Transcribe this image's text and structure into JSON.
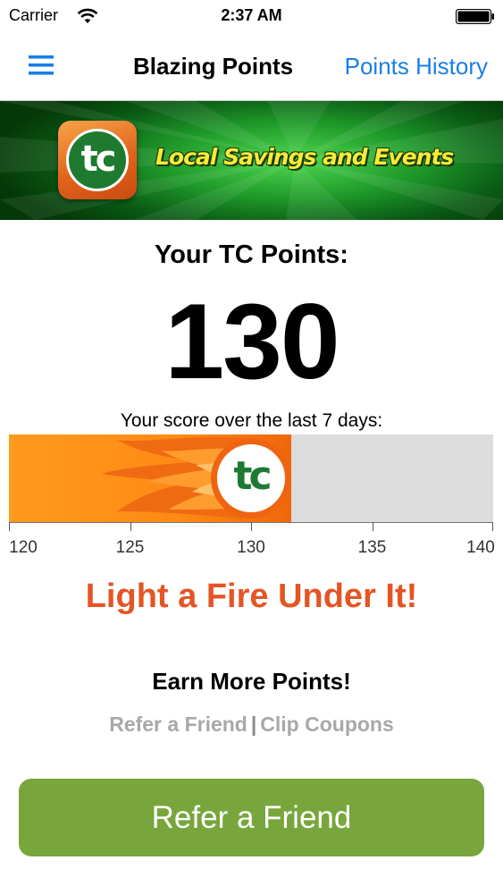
{
  "status_bar": {
    "carrier": "Carrier",
    "time": "2:37 AM",
    "icons": [
      "wifi-icon",
      "battery-icon"
    ]
  },
  "nav": {
    "menu_icon": "hamburger-menu-icon",
    "title": "Blazing Points",
    "link": "Points History",
    "link_color": "#1a7ee8"
  },
  "banner": {
    "logo_text": "tc",
    "slogan": "Local Savings and Events"
  },
  "points": {
    "heading": "Your TC Points:",
    "value": "130"
  },
  "score": {
    "caption": "Your score over the last 7 days:",
    "gauge_min": 120,
    "gauge_max": 140,
    "gauge_value": 130,
    "knob_text": "tc",
    "ticks": [
      "120",
      "125",
      "130",
      "135",
      "140"
    ]
  },
  "motivation": {
    "headline": "Light a Fire Under It!",
    "headline_color": "#e45525"
  },
  "earn": {
    "heading": "Earn More Points!",
    "link_refer": "Refer a Friend",
    "separator": "|",
    "link_coupons": "Clip Coupons"
  },
  "cta": {
    "label": "Refer a Friend",
    "color": "#78a63c"
  }
}
